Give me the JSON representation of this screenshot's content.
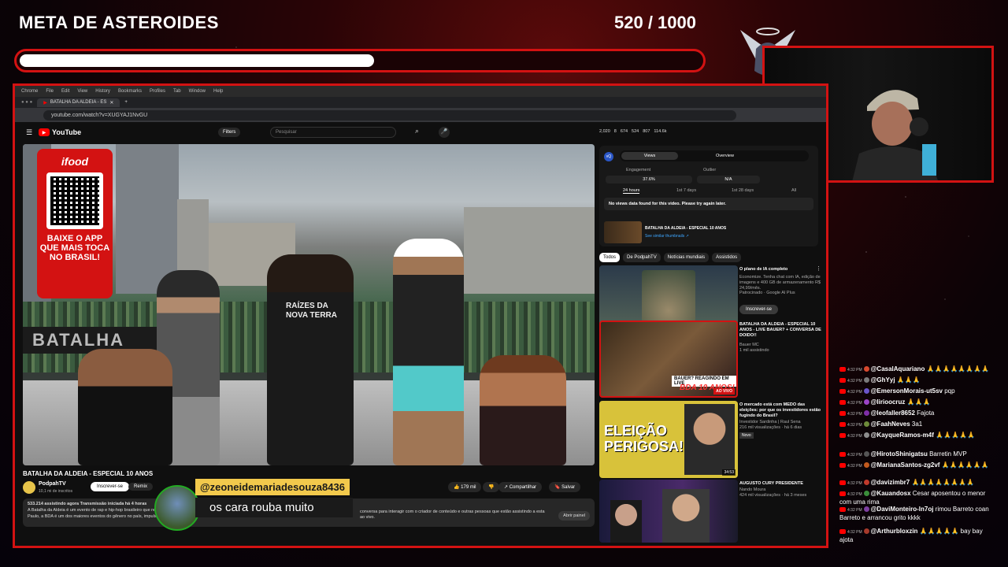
{
  "overlay": {
    "goal_title": "META DE ASTEROIDES",
    "goal_count": "520 / 1000",
    "goal_progress": 0.52
  },
  "browser": {
    "menu": [
      "Chrome",
      "File",
      "Edit",
      "View",
      "History",
      "Bookmarks",
      "Profiles",
      "Tab",
      "Window",
      "Help"
    ],
    "tab_title": "BATALHA DA ALDEIA - ES",
    "url": "youtube.com/watch?v=XUGYAJ1NvGU"
  },
  "youtube": {
    "logo": "YouTube",
    "filters": "Filters",
    "search_placeholder": "Pesquisar",
    "stats": [
      "2,020",
      "8",
      "674",
      "524",
      "807",
      "114.6k"
    ],
    "video_title": "BATALHA DA ALDEIA - ESPECIAL 10 ANOS",
    "channel_name": "PodpahTV",
    "channel_subs": "10,1 mi de inscritos",
    "subscribe": "Inscrever-se",
    "remix": "Remix",
    "likes": "179 mil",
    "share": "Compartilhar",
    "save": "Salvar",
    "desc_line1": "533.214 assistindo agora  Transmissão iniciada há 4 horas",
    "desc_line2": "A Batalha da Aldeia é um evento de rap e hip-hop brasileiro que re",
    "desc_line3": "Paulo, a BDA é um dos maiores eventos do gênero no país, impulsi",
    "chat_note_line1": "conversa para interagir com o criador de conteúdo e outras pessoas que estão assistindo a esta",
    "chat_note_line2": "ao vivo.",
    "open_panel": "Abrir painel",
    "ifood_logo": "ifood",
    "ifood_text": "BAIXE O APP QUE MAIS TOCA NO BRASIL!",
    "shirt_text": "RAÍZES DA NOVA TERRA",
    "banner_text": "BATALHA"
  },
  "sidepanel": {
    "tab_views": "Views",
    "tab_overview": "Overview",
    "engagement_label": "Engagement",
    "engagement_value": "37.6%",
    "outlier_label": "Outlier",
    "outlier_value": "N/A",
    "range_24h": "24 hours",
    "range_7d": "1st 7 days",
    "range_28d": "1st 28 days",
    "range_all": "All",
    "no_data": "No views data found for this video. Please try again later.",
    "mini_title": "BATALHA DA ALDEIA - ESPECIAL 10 ANOS",
    "mini_link": "See similar thumbnails ↗"
  },
  "related_filters": [
    "Todos",
    "De PodpahTV",
    "Notícias mundiais",
    "Assistidos"
  ],
  "related": [
    {
      "title": "O plano de IA completo",
      "meta": "Economize. Tenha chat com IA, edição de imagens e 400 GB de armazenamento R$ 24,99/mês.",
      "channel": "Patrocinado · Google AI Plus",
      "button": "Inscrever-se"
    },
    {
      "title": "BATALHA DA ALDEIA - ESPECIAL 10 ANOS - LIVE BAUER? + CONVERSA DE DOIDO!!",
      "channel": "Bauer MC",
      "views": "1 mil assistindo",
      "thumb_text": "BAUER? REAGINDO EM LIVE",
      "thumb_text2": "BDA 10 ANOS!",
      "live": "AO VIVO"
    },
    {
      "title": "O mercado está com MEDO das eleições: por que os investidores estão fugindo do Brasil?",
      "channel": "Investidor Sardinha | Raul Sena",
      "views": "216 mil visualizações · há 6 dias",
      "badge": "Novo",
      "thumb_text": "ELEIÇÃO PERIGOSA!",
      "duration": "34:53"
    },
    {
      "title": "AUGUSTO CURY PRESIDENTE",
      "channel": "Nando Moura",
      "views": "424 mil visualizações · há 3 meses"
    }
  ],
  "featured_chat": {
    "user": "@zeoneidemariadesouza8436",
    "text": "os cara rouba muito"
  },
  "chat": [
    {
      "time": "4:32 PM",
      "user": "@CasalAquariano",
      "text": "🙏🙏🙏🙏🙏🙏🙏🙏",
      "color": "#d8492f"
    },
    {
      "time": "4:32 PM",
      "user": "@GhYyj",
      "text": "🙏🙏🙏",
      "color": "#7a7a7a"
    },
    {
      "time": "4:32 PM",
      "user": "@EmersonMorais-ut5sv",
      "text": "pqp",
      "color": "#6a55c9"
    },
    {
      "time": "4:32 PM",
      "user": "@Iirioocruz",
      "text": "🙏🙏🙏",
      "color": "#9b44c6"
    },
    {
      "time": "4:32 PM",
      "user": "@leofaller8652",
      "text": "Fajota",
      "color": "#7f2ea8"
    },
    {
      "time": "4:32 PM",
      "user": "@FaahNeves",
      "text": "3a1",
      "color": "#6d8a3a"
    },
    {
      "time": "4:32 PM",
      "user": "@KayqueRamos-m4f",
      "text": "🙏🙏🙏🙏🙏",
      "color": "#8c8c8c"
    },
    {
      "time": "4:32 PM",
      "user": "@HirotoShinigatsu",
      "text": "Barretin MVP",
      "color": "#555"
    },
    {
      "time": "4:32 PM",
      "user": "@MarianaSantos-zg2vf",
      "text": "🙏🙏🙏🙏🙏🙏",
      "color": "#c25a1e"
    },
    {
      "time": "4:32 PM",
      "user": "@davizimbr7",
      "text": "🙏🙏🙏🙏🙏🙏🙏🙏",
      "color": "#c0392b"
    },
    {
      "time": "4:32 PM",
      "user": "@Kauandosx",
      "text": "Cesar aposentou o menor com uma rima",
      "color": "#3a8d3a"
    },
    {
      "time": "4:32 PM",
      "user": "@DaviMonteiro-ln7oj",
      "text": "rimou Barreto coan Barreto e arrancou grito kkkk",
      "color": "#7d3fa0"
    },
    {
      "time": "4:32 PM",
      "user": "@Arthurbloxzin",
      "text": "🙏🙏🙏🙏🙏 bay bay ajota",
      "color": "#a63a2b"
    }
  ]
}
